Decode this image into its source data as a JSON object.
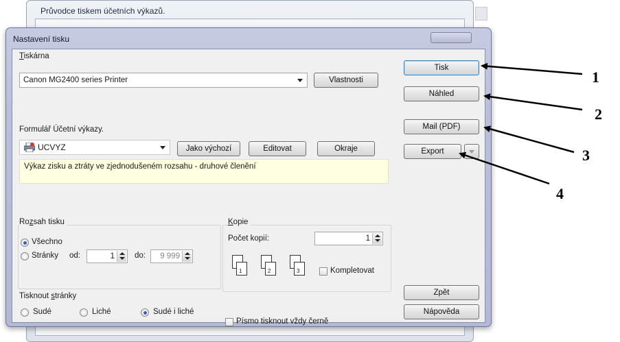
{
  "background_window": {
    "title": "Průvodce tiskem účetních výkazů."
  },
  "dialog": {
    "title": "Nastavení tisku",
    "printer": {
      "group_label_prefix": "",
      "group_label_accel": "T",
      "group_label_rest": "iskárna",
      "selected": "Canon MG2400 series Printer",
      "properties_button": "Vlastnosti"
    },
    "form": {
      "label": "Formulář  Účetní výkazy.",
      "selected": "UCVYZ",
      "default_button": "Jako výchozí",
      "edit_button": "Editovat",
      "margins_button": "Okraje",
      "description": "Výkaz zisku a ztráty ve zjednodušeném rozsahu - druhové členění"
    },
    "range": {
      "label_pre": "Ro",
      "label_accel": "z",
      "label_post": "sah tisku",
      "all_label": "Všechno",
      "pages_label": "Stránky",
      "from_label": "od:",
      "from_value": "1",
      "to_label": "do:",
      "to_value": "9 999",
      "selected": "all"
    },
    "print_pages": {
      "label_pre": "Tisknout ",
      "label_accel": "s",
      "label_post": "tránky",
      "even_label": "Sudé",
      "odd_label": "Liché",
      "both_label": "Sudé i liché",
      "selected": "both"
    },
    "copies": {
      "label_accel": "K",
      "label_rest": "opie",
      "count_label": "Počet kopií:",
      "count_value": "1",
      "collate_label": "Kompletovat",
      "collate_checked": false,
      "page_numbers": [
        "1",
        "2",
        "3"
      ]
    },
    "black_font_label": "Písmo tisknout vždy černě",
    "black_font_checked": false,
    "side_buttons": {
      "print": "Tisk",
      "preview": "Náhled",
      "mail_pdf": "Mail (PDF)",
      "export": "Export",
      "back": "Zpět",
      "help": "Nápověda"
    }
  },
  "annotations": [
    "1",
    "2",
    "3",
    "4"
  ]
}
